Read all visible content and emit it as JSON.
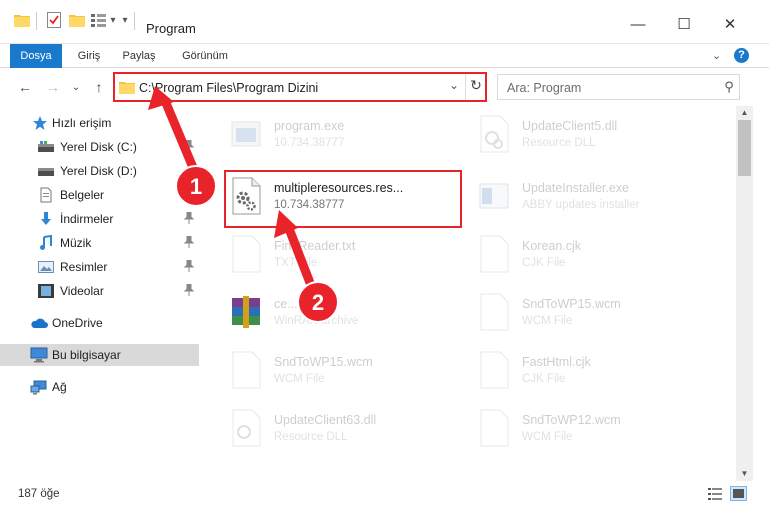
{
  "window": {
    "title": "Program",
    "minimize_glyph": "—",
    "maximize_glyph": "☐",
    "close_glyph": "✕",
    "help_glyph": "?",
    "ribbon_toggle_glyph": "⌄",
    "qa_dropdown_glyph": "▾"
  },
  "ribbon": {
    "tabs": [
      "Dosya",
      "Giriş",
      "Paylaş",
      "Görünüm"
    ]
  },
  "nav": {
    "back_glyph": "←",
    "forward_glyph": "→",
    "recent_glyph": "⌄",
    "up_glyph": "↑",
    "address": "C:\\Program Files\\Program Dizini",
    "address_dropdown_glyph": "⌄",
    "refresh_glyph": "↻",
    "search_placeholder": "Ara: Program",
    "search_glyph": "⚲"
  },
  "sidebar": {
    "items": [
      {
        "label": "Hızlı erişim",
        "icon": "star-icon"
      },
      {
        "label": "Yerel Disk (C:)",
        "icon": "drive-icon"
      },
      {
        "label": "Yerel Disk (D:)",
        "icon": "drive-icon"
      },
      {
        "label": "Belgeler",
        "icon": "documents-icon"
      },
      {
        "label": "İndirmeler",
        "icon": "downloads-icon"
      },
      {
        "label": "Müzik",
        "icon": "music-icon"
      },
      {
        "label": "Resimler",
        "icon": "pictures-icon"
      },
      {
        "label": "Videolar",
        "icon": "videos-icon"
      },
      {
        "label": "OneDrive",
        "icon": "cloud-icon"
      },
      {
        "label": "Bu bilgisayar",
        "icon": "computer-icon"
      },
      {
        "label": "Ağ",
        "icon": "network-icon"
      }
    ],
    "pin_glyph": "📌"
  },
  "files": [
    {
      "name": "program.exe",
      "type": "10.734.38777",
      "icon": "exe-icon"
    },
    {
      "name": "UpdateClient5.dll",
      "type": "Resource DLL",
      "icon": "dll-icon"
    },
    {
      "name": "multipleresources.res...",
      "type": "10.734.38777",
      "icon": "gear-file-icon"
    },
    {
      "name": "UpdateInstaller.exe",
      "type": "ABBY updates installer",
      "icon": "installer-icon"
    },
    {
      "name": "FineReader.txt",
      "type": "TXT File",
      "icon": "txt-icon"
    },
    {
      "name": "Korean.cjk",
      "type": "CJK File",
      "icon": "file-icon"
    },
    {
      "name": "ce...s.cab",
      "type": "WinRAR archive",
      "icon": "winrar-icon"
    },
    {
      "name": "SndToWP15.wcm",
      "type": "WCM File",
      "icon": "file-icon"
    },
    {
      "name": "SndToWP15.wcm",
      "type": "WCM File",
      "icon": "file-icon"
    },
    {
      "name": "FastHtml.cjk",
      "type": "CJK File",
      "icon": "file-icon"
    },
    {
      "name": "UpdateClient63.dll",
      "type": "Resource DLL",
      "icon": "dll-icon"
    },
    {
      "name": "SndToWP12.wcm",
      "type": "WCM File",
      "icon": "file-icon"
    }
  ],
  "annotations": {
    "badge1": "1",
    "badge2": "2",
    "color": "#e8232a"
  },
  "status": {
    "count": "187 öğe"
  }
}
